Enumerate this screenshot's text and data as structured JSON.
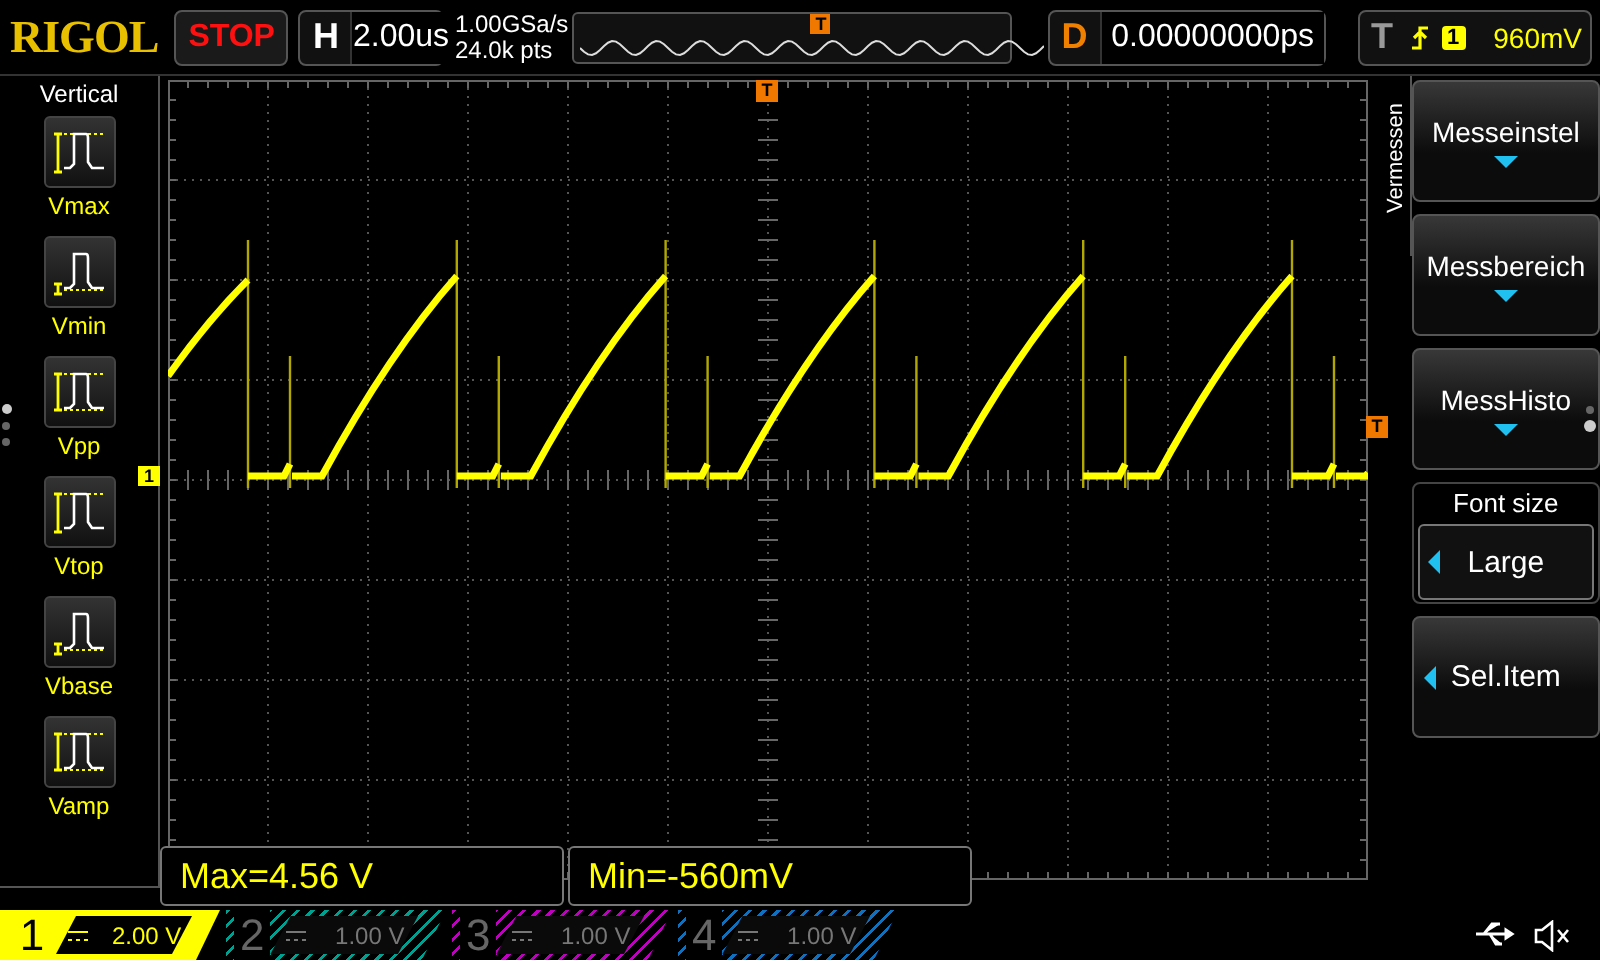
{
  "top_bar": {
    "logo": "RIGOL",
    "run_state": "STOP",
    "horizontal": {
      "label": "H",
      "value": "2.00us"
    },
    "sample_rate": "1.00GSa/s",
    "memory_depth": "24.0k pts",
    "overview_marker": "T",
    "delay": {
      "label": "D",
      "value": "0.00000000ps"
    },
    "trigger": {
      "label": "T",
      "source": "1",
      "level": "960mV"
    }
  },
  "side_panel": {
    "title": "Vertical",
    "items": [
      {
        "kind": "max",
        "label": "Vmax"
      },
      {
        "kind": "min",
        "label": "Vmin"
      },
      {
        "kind": "pp",
        "label": "Vpp"
      },
      {
        "kind": "top",
        "label": "Vtop"
      },
      {
        "kind": "base",
        "label": "Vbase"
      },
      {
        "kind": "amp",
        "label": "Vamp"
      }
    ],
    "pager": [
      {
        "selected": true
      },
      {
        "selected": false
      },
      {
        "selected": false
      }
    ]
  },
  "display": {
    "trigger_position_marker": "T",
    "trigger_level_marker": "T",
    "channel_marker": "1",
    "measurements": [
      "Max=4.56 V",
      "Min=-560mV"
    ]
  },
  "menu": {
    "title": "Vermessen",
    "items": [
      {
        "kind": "dropdown",
        "label": "Messeinstel"
      },
      {
        "kind": "dropdown",
        "label": "Messbereich"
      },
      {
        "kind": "dropdown",
        "label": "MessHisto"
      },
      {
        "kind": "select",
        "title": "Font size",
        "value": "Large"
      },
      {
        "kind": "action",
        "label": "Sel.Item"
      }
    ],
    "pager": [
      {
        "selected": false
      },
      {
        "selected": true
      }
    ]
  },
  "channels": [
    {
      "number": "1",
      "scale": "2.00 V",
      "on": true,
      "color": "#ffff00"
    },
    {
      "number": "2",
      "scale": "1.00 V",
      "on": false,
      "color": "#00a090"
    },
    {
      "number": "3",
      "scale": "1.00 V",
      "on": false,
      "color": "#c000c0"
    },
    {
      "number": "4",
      "scale": "1.00 V",
      "on": false,
      "color": "#1070c0"
    }
  ]
}
